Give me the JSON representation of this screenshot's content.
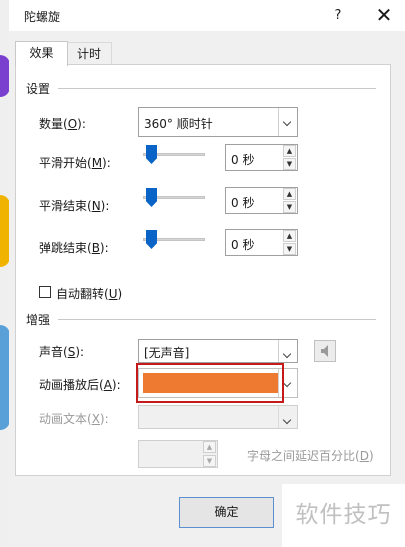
{
  "window": {
    "title": "陀螺旋",
    "help_symbol": "?",
    "close_symbol": "✕"
  },
  "tabs": [
    {
      "label": "效果",
      "active": true
    },
    {
      "label": "计时",
      "active": false
    }
  ],
  "settings": {
    "group_label": "设置",
    "amount": {
      "label": "数量(",
      "key": "O",
      "label_end": "):",
      "value": "360° 顺时针"
    },
    "smooth_start": {
      "label": "平滑开始(",
      "key": "M",
      "label_end": "):",
      "value": "0 秒"
    },
    "smooth_end": {
      "label": "平滑结束(",
      "key": "N",
      "label_end": "):",
      "value": "0 秒"
    },
    "bounce_end": {
      "label": "弹跳结束(",
      "key": "B",
      "label_end": "):",
      "value": "0 秒"
    },
    "auto_reverse": {
      "label": "自动翻转(",
      "key": "U",
      "label_end": ")",
      "checked": false
    }
  },
  "enhancements": {
    "group_label": "增强",
    "sound": {
      "label": "声音(",
      "key": "S",
      "label_end": "):",
      "value": "[无声音]"
    },
    "after_animation": {
      "label": "动画播放后(",
      "key": "A",
      "label_end": "):",
      "color": "#ee7a32",
      "highlight": "#c41a1a"
    },
    "animate_text": {
      "label": "动画文本(",
      "key": "X",
      "label_end": "):",
      "value": ""
    },
    "letter_delay": {
      "value": "",
      "label": "字母之间延迟百分比(",
      "key": "D",
      "label_end": ")"
    }
  },
  "buttons": {
    "ok": "确定"
  },
  "watermark": "软件技巧",
  "colors": {
    "slider_thumb": "#0a64c8",
    "ok_border": "#5a8fd0"
  }
}
